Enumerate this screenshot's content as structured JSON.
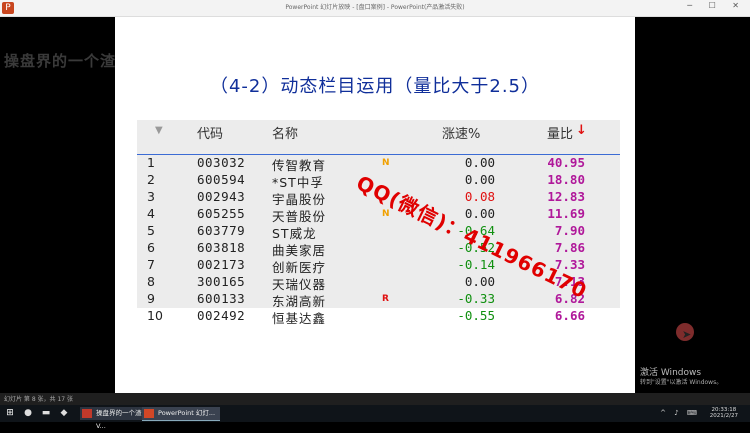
{
  "window": {
    "title": "PowerPoint 幻灯片放映 - [盘口案例] - PowerPoint(产品激活失败)",
    "app_icon_glyph": "P",
    "controls": "─ ☐ ✕"
  },
  "overlay_text": "操盘界的一个渣流",
  "slide": {
    "title": "（4-2）动态栏目运用（量比大于2.5）",
    "headers": {
      "code": "代码",
      "name": "名称",
      "change": "涨速%",
      "ratio": "量比",
      "ratio_sort_icon": "↓"
    },
    "rows": [
      {
        "idx": "1",
        "code": "003032",
        "name": "传智教育",
        "flag": "N",
        "change": "0.00",
        "ratio": "40.95"
      },
      {
        "idx": "2",
        "code": "600594",
        "name": "*ST中孚",
        "flag": "",
        "change": "0.00",
        "ratio": "18.80"
      },
      {
        "idx": "3",
        "code": "002943",
        "name": "宇晶股份",
        "flag": "",
        "change": "0.08",
        "ratio": "12.83"
      },
      {
        "idx": "4",
        "code": "605255",
        "name": "天普股份",
        "flag": "N",
        "change": "0.00",
        "ratio": "11.69"
      },
      {
        "idx": "5",
        "code": "603779",
        "name": "ST威龙",
        "flag": "",
        "change": "-0.64",
        "ratio": "7.90"
      },
      {
        "idx": "6",
        "code": "603818",
        "name": "曲美家居",
        "flag": "",
        "change": "-0.52",
        "ratio": "7.86"
      },
      {
        "idx": "7",
        "code": "002173",
        "name": "创新医疗",
        "flag": "",
        "change": "-0.14",
        "ratio": "7.33"
      },
      {
        "idx": "8",
        "code": "300165",
        "name": "天瑞仪器",
        "flag": "",
        "change": "0.00",
        "ratio": "7.13"
      },
      {
        "idx": "9",
        "code": "600133",
        "name": "东湖高新",
        "flag": "R",
        "change": "-0.33",
        "ratio": "6.82"
      },
      {
        "idx": "10",
        "code": "002492",
        "name": "恒基达鑫",
        "flag": "",
        "change": "-0.55",
        "ratio": "6.66"
      }
    ],
    "watermark": "QQ(微信)：411966170"
  },
  "activation_notice": {
    "line1": "激活 Windows",
    "line2": "转到\"设置\"以激活 Windows。"
  },
  "status_bar": {
    "text": "幻灯片 第 8 张，共 17 张"
  },
  "taskbar": {
    "apps": [
      {
        "label": "操盘界的一个渣流V...",
        "color": "#c0392b"
      },
      {
        "label": "PowerPoint 幻灯...",
        "color": "#d24726"
      }
    ],
    "time": "20:33:18",
    "date": "2021/2/27"
  },
  "colors": {
    "title": "#102f9a",
    "up": "#e01010",
    "down": "#109010",
    "flat": "#222222",
    "ratio": "#b0189a",
    "flag_n": "#f0a000",
    "flag_r": "#e01010",
    "watermark": "#e00000"
  }
}
